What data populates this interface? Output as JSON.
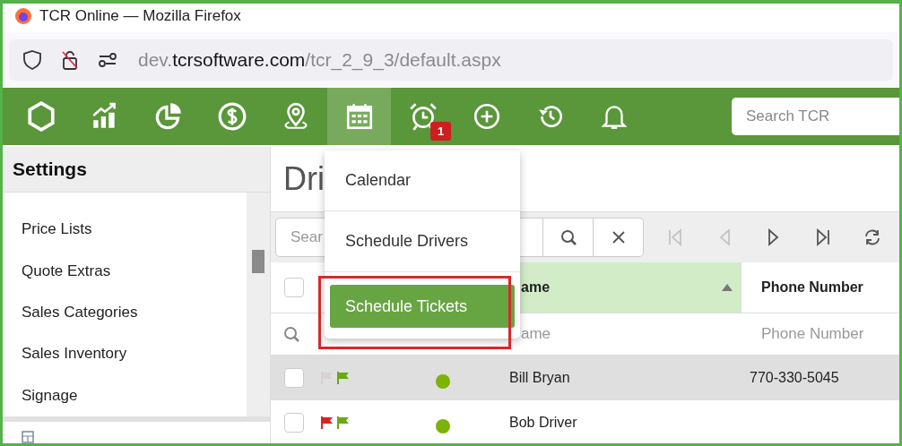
{
  "window": {
    "title": "TCR Online — Mozilla Firefox"
  },
  "address_bar": {
    "prefix": "dev.",
    "domain": "tcrsoftware.com",
    "path": "/tcr_2_9_3/default.aspx"
  },
  "nav": [
    {
      "kind": "logo",
      "selected": false
    },
    {
      "kind": "chart",
      "selected": false
    },
    {
      "kind": "pie",
      "selected": false
    },
    {
      "kind": "dollar",
      "selected": false
    },
    {
      "kind": "pin",
      "selected": false
    },
    {
      "kind": "calendar",
      "selected": true
    },
    {
      "kind": "alarm",
      "selected": false,
      "badge": "1"
    },
    {
      "kind": "add",
      "selected": false
    },
    {
      "kind": "history",
      "selected": false
    },
    {
      "kind": "bell",
      "selected": false
    }
  ],
  "search": {
    "placeholder": "Search TCR"
  },
  "sidebar": {
    "title": "Settings",
    "items": [
      "Price Lists",
      "Quote Extras",
      "Sales Categories",
      "Sales Inventory",
      "Signage"
    ]
  },
  "page": {
    "heading": "Dri"
  },
  "toolbar": {
    "search_placeholder": "Sear",
    "search_buttons": [
      {
        "kind": "search"
      },
      {
        "kind": "clear"
      }
    ],
    "buttons": [
      {
        "kind": "first",
        "disabled": true
      },
      {
        "kind": "prev",
        "disabled": true
      },
      {
        "kind": "next",
        "disabled": false
      },
      {
        "kind": "last",
        "disabled": false
      },
      {
        "kind": "refresh",
        "disabled": false
      }
    ]
  },
  "table": {
    "select_all": {
      "checked": false
    },
    "columns": [
      {
        "label": "ame",
        "sorted": true
      },
      {
        "label": "Phone Number",
        "sorted": false
      }
    ],
    "filters": [
      "ame",
      "Phone Number"
    ],
    "rows": [
      {
        "selected": true,
        "checked": false,
        "flags": [
          {
            "color": "#d9d2d2"
          },
          {
            "color": "#6aa814"
          }
        ],
        "status": {
          "color": "#7cb305"
        },
        "name": "Bill Bryan",
        "phone": "770-330-5045"
      },
      {
        "selected": false,
        "checked": false,
        "flags": [
          {
            "color": "#e02020"
          },
          {
            "color": "#6aa814"
          }
        ],
        "status": {
          "color": "#7cb305"
        },
        "name": "Bob Driver"
      }
    ]
  },
  "menu": {
    "items": [
      {
        "label": "Calendar",
        "selected": false
      },
      {
        "label": "Schedule Drivers",
        "selected": false
      },
      {
        "label": "Schedule Tickets",
        "selected": true
      }
    ]
  }
}
